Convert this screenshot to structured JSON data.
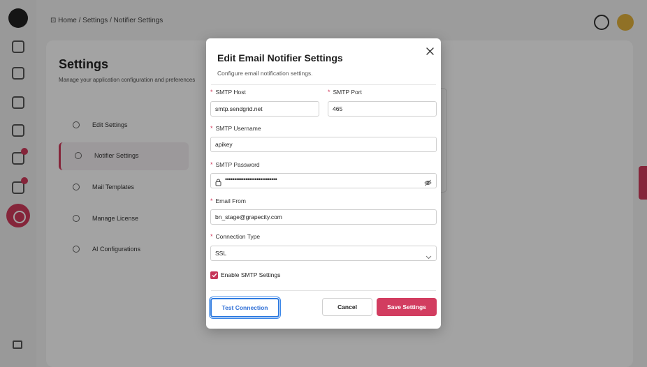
{
  "app": {
    "breadcrumb": "⊡ Home / Settings / Notifier Settings",
    "page_title": "Settings",
    "page_subtitle": "Manage your application configuration and preferences",
    "menu": [
      {
        "label": "Edit Settings",
        "icon": "edit-icon"
      },
      {
        "label": "Notifier Settings",
        "icon": "bell-icon",
        "active": true
      },
      {
        "label": "Mail Templates",
        "icon": "mail-icon"
      },
      {
        "label": "Manage License",
        "icon": "key-icon"
      },
      {
        "label": "AI Configurations",
        "icon": "sparkle-icon"
      }
    ]
  },
  "modal": {
    "title": "Edit Email Notifier Settings",
    "subtitle": "Configure email notification settings.",
    "required_mark": "*",
    "smtp_host": {
      "label": "SMTP Host",
      "value": "smtp.sendgrid.net"
    },
    "smtp_port": {
      "label": "SMTP Port",
      "value": "465"
    },
    "smtp_username": {
      "label": "SMTP Username",
      "value": "apikey"
    },
    "smtp_password": {
      "label": "SMTP Password",
      "value": "••••••••••••••••••••••••••••"
    },
    "email_from": {
      "label": "Email From",
      "value": "bn_stage@grapecity.com"
    },
    "connection_type": {
      "label": "Connection Type",
      "value": "SSL"
    },
    "enable_smtp": {
      "label": "Enable SMTP Settings",
      "checked": true
    },
    "buttons": {
      "test": "Test Connection",
      "cancel": "Cancel",
      "save": "Save Settings"
    }
  },
  "colors": {
    "accent": "#d23d60",
    "focus": "#2f7be0"
  }
}
